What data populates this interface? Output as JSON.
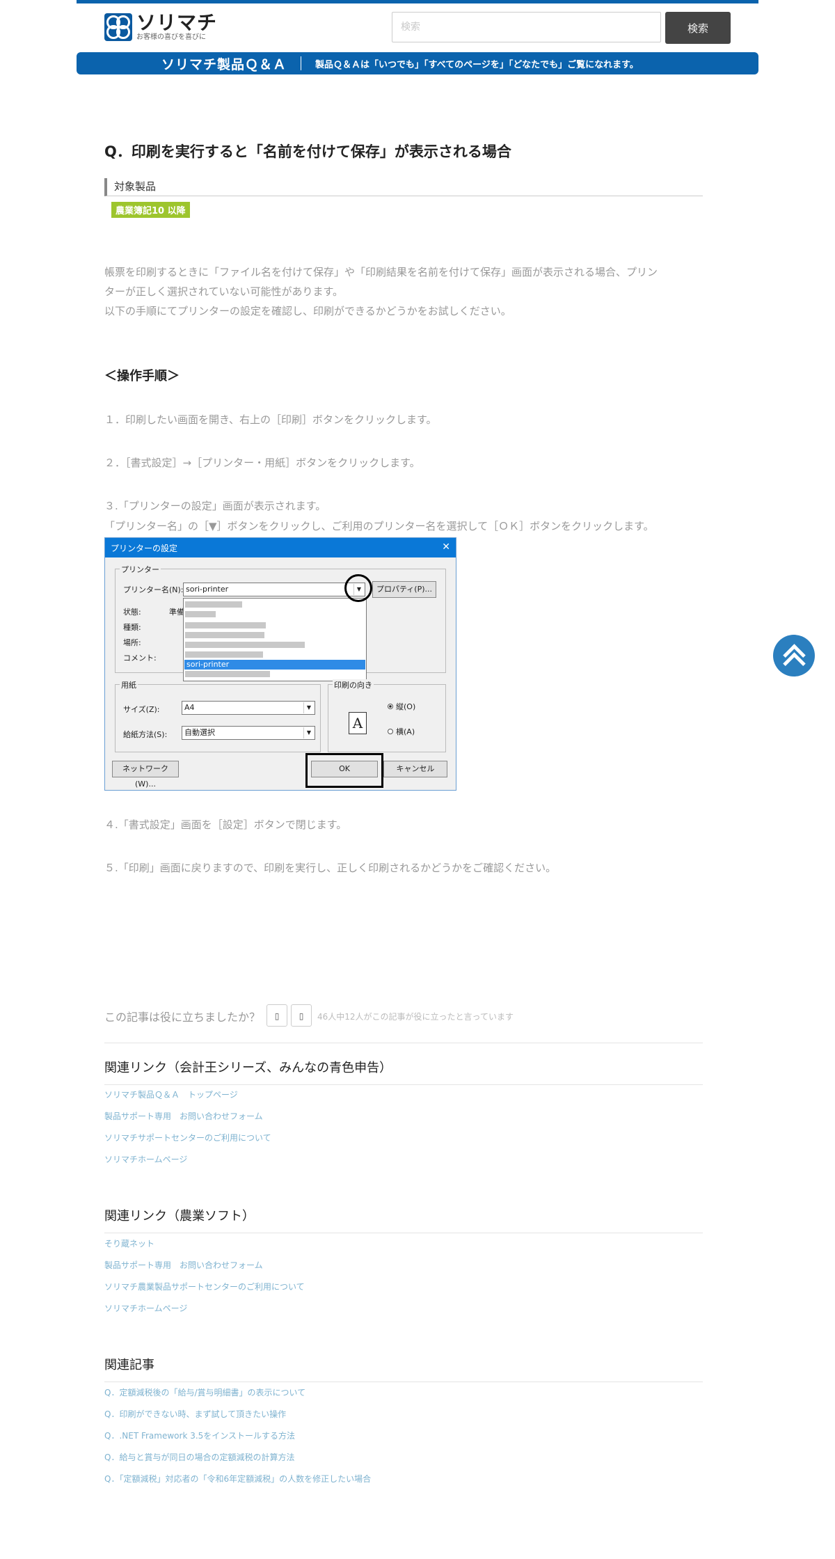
{
  "header": {
    "logo_name": "ソリマチ",
    "logo_tagline": "お客様の喜びを喜びに",
    "search_placeholder": "検索",
    "search_button": "検索"
  },
  "banner": {
    "title": "ソリマチ製品Ｑ＆Ａ",
    "subtitle": "製品Ｑ＆Ａは「いつでも」「すべてのページを」「どなたでも」ご覧になれます。"
  },
  "article": {
    "title": "Q．印刷を実行すると「名前を付けて保存」が表示される場合",
    "target_heading": "対象製品",
    "target_badge": "農業簿記10 以降",
    "intro": [
      "帳票を印刷するときに「ファイル名を付けて保存」や「印刷結果を名前を付けて保存」画面が表示される場合、プリン",
      "ターが正しく選択されていない可能性があります。",
      "以下の手順にてプリンターの設定を確認し、印刷ができるかどうかをお試しください。"
    ],
    "procedure_heading": "＜操作手順＞",
    "steps": [
      "１．印刷したい画面を開き、右上の［印刷］ボタンをクリックします。",
      "２．［書式設定］→［プリンター・用紙］ボタンをクリックします。",
      "３.「プリンターの設定」画面が表示されます。",
      "「プリンター名」の［▼］ボタンをクリックし、ご利用のプリンター名を選択して［ＯＫ］ボタンをクリックします。",
      "４.「書式設定」画面を［設定］ボタンで閉じます。",
      "５.「印刷」画面に戻りますので、印刷を実行し、正しく印刷されるかどうかをご確認ください。"
    ]
  },
  "dialog": {
    "title": "プリンターの設定",
    "close_glyph": "✕",
    "printer_group": "プリンター",
    "printer_name_label": "プリンター名(N):",
    "printer_name_value": "sori-printer",
    "properties_button": "プロパティ(P)...",
    "status_label": "状態:",
    "status_value": "準備",
    "type_label": "種類:",
    "location_label": "場所:",
    "comment_label": "コメント:",
    "dropdown_selected": "sori-printer",
    "paper_group": "用紙",
    "size_label": "サイズ(Z):",
    "size_value": "A4",
    "feed_label": "給紙方法(S):",
    "feed_value": "自動選択",
    "orientation_group": "印刷の向き",
    "portrait": "縦(O)",
    "landscape": "横(A)",
    "paper_icon_glyph": "A",
    "network_button": "ネットワーク(W)...",
    "ok_button": "OK",
    "cancel_button": "キャンセル"
  },
  "feedback": {
    "question": "この記事は役に立ちましたか？",
    "yes_glyph": "▯",
    "no_glyph": "▯",
    "count_text": "46人中12人がこの記事が役に立ったと言っています"
  },
  "related_accounting": {
    "title": "関連リンク（会計王シリーズ、みんなの青色申告）",
    "links": [
      "ソリマチ製品Ｑ＆Ａ　トップページ",
      "製品サポート専用　お問い合わせフォーム",
      "ソリマチサポートセンターのご利用について",
      "ソリマチホームページ"
    ]
  },
  "related_agri": {
    "title": "関連リンク（農業ソフト）",
    "links": [
      "そり蔵ネット",
      "製品サポート専用　お問い合わせフォーム",
      "ソリマチ農業製品サポートセンターのご利用について",
      "ソリマチホームページ"
    ]
  },
  "related_articles": {
    "title": "関連記事",
    "links": [
      "Q．定額減税後の「給与/賞与明細書」の表示について",
      "Q．印刷ができない時、まず試して頂きたい操作",
      "Q．.NET Framework 3.5をインストールする方法",
      "Q．給与と賞与が同日の場合の定額減税の計算方法",
      "Q．「定額減税」対応者の「令和6年定額減税」の人数を修正したい場合"
    ]
  },
  "colors": {
    "brand": "#0b63ad",
    "badge": "#9dc52d",
    "link": "#7fb3d0"
  },
  "icons": {
    "back_to_top": "double-chevron-up-icon"
  }
}
